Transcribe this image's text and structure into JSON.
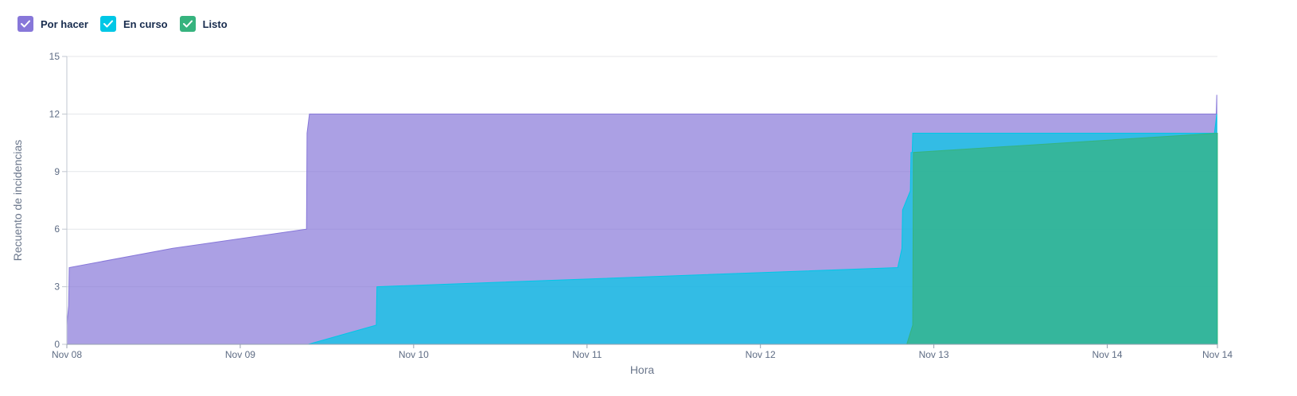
{
  "legend": [
    {
      "label": "Por hacer",
      "color": "#8777d9"
    },
    {
      "label": "En curso",
      "color": "#00c7e6"
    },
    {
      "label": "Listo",
      "color": "#36b37e"
    }
  ],
  "chart_data": {
    "type": "area",
    "stacking": "overlaid cumulative",
    "title": "",
    "xlabel": "Hora",
    "ylabel": "Recuento de incidencias",
    "ylim": [
      0,
      15
    ],
    "yticks": [
      0,
      3,
      6,
      9,
      12,
      15
    ],
    "xlim": [
      "2023-11-08 00:00",
      "2023-11-14 15:15"
    ],
    "xticks": [
      {
        "t": "2023-11-08 00:00",
        "label": "Nov 08"
      },
      {
        "t": "2023-11-09 00:00",
        "label": "Nov 09"
      },
      {
        "t": "2023-11-10 00:00",
        "label": "Nov 10"
      },
      {
        "t": "2023-11-11 00:00",
        "label": "Nov 11"
      },
      {
        "t": "2023-11-12 00:00",
        "label": "Nov 12"
      },
      {
        "t": "2023-11-13 00:00",
        "label": "Nov 13"
      },
      {
        "t": "2023-11-14 00:00",
        "label": "Nov 14"
      },
      {
        "t": "2023-11-14 15:15",
        "label": "Nov 14"
      }
    ],
    "grid": true,
    "legend_position": "top-left",
    "series": [
      {
        "name": "Por hacer",
        "color": "#8777d9",
        "points": [
          [
            "2023-11-08 00:00",
            1
          ],
          [
            "2023-11-08 00:15",
            2
          ],
          [
            "2023-11-08 00:20",
            4
          ],
          [
            "2023-11-08 14:40",
            5
          ],
          [
            "2023-11-09 09:10",
            6
          ],
          [
            "2023-11-09 09:15",
            11
          ],
          [
            "2023-11-09 09:35",
            12
          ],
          [
            "2023-11-14 15:05",
            12
          ],
          [
            "2023-11-14 15:10",
            13
          ]
        ]
      },
      {
        "name": "En curso",
        "color": "#00c7e6",
        "points": [
          [
            "2023-11-08 00:00",
            0
          ],
          [
            "2023-11-09 09:25",
            0
          ],
          [
            "2023-11-09 18:50",
            1
          ],
          [
            "2023-11-09 18:55",
            3
          ],
          [
            "2023-11-12 19:00",
            4
          ],
          [
            "2023-11-12 19:35",
            5
          ],
          [
            "2023-11-12 19:40",
            7
          ],
          [
            "2023-11-12 20:45",
            8
          ],
          [
            "2023-11-12 20:50",
            10
          ],
          [
            "2023-11-12 21:00",
            10
          ],
          [
            "2023-11-12 21:05",
            11
          ],
          [
            "2023-11-14 14:50",
            11
          ],
          [
            "2023-11-14 15:10",
            12
          ]
        ]
      },
      {
        "name": "Listo",
        "color": "#36b37e",
        "points": [
          [
            "2023-11-08 00:00",
            0
          ],
          [
            "2023-11-12 20:15",
            0
          ],
          [
            "2023-11-12 21:05",
            1
          ],
          [
            "2023-11-12 21:10",
            10
          ],
          [
            "2023-11-14 15:15",
            11
          ]
        ]
      }
    ]
  }
}
